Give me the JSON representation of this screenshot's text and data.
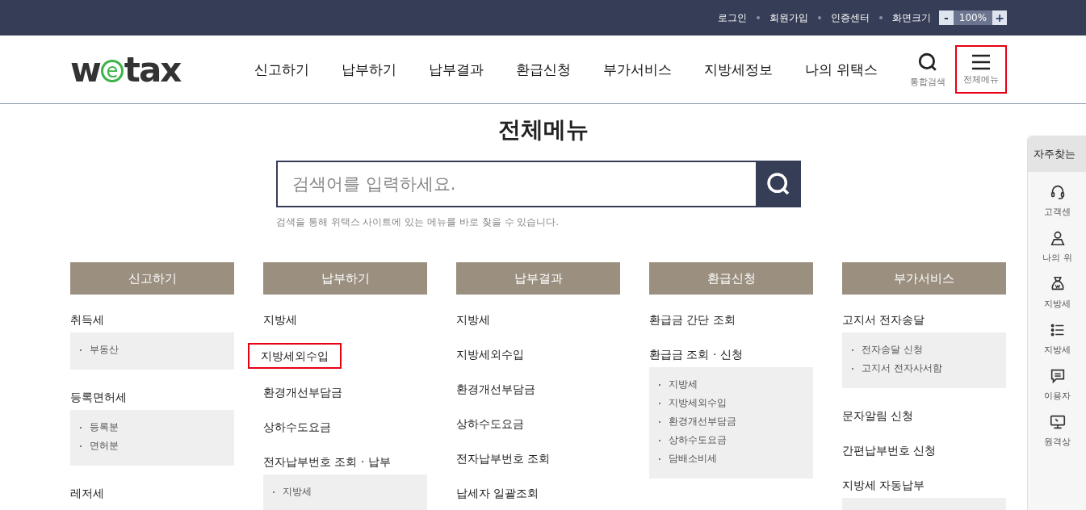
{
  "top_bar": {
    "links": [
      "로그인",
      "회원가입",
      "인증센터"
    ],
    "zoom": {
      "label": "화면크기",
      "minus": "-",
      "value": "100%",
      "plus": "+"
    }
  },
  "header": {
    "logo": {
      "before": "w",
      "mark": "e",
      "after": "tax"
    },
    "nav": [
      "신고하기",
      "납부하기",
      "납부결과",
      "환급신청",
      "부가서비스",
      "지방세정보",
      "나의 위택스"
    ],
    "tools": [
      {
        "kind": "search",
        "label": "통합검색",
        "highlighted": false
      },
      {
        "kind": "menu",
        "label": "전체메뉴",
        "highlighted": true
      }
    ]
  },
  "page_title": "전체메뉴",
  "search": {
    "placeholder": "검색어를 입력하세요.",
    "hint": "검색을 통해 위택스 사이트에 있는 메뉴를 바로 찾을 수 있습니다."
  },
  "columns": [
    {
      "title": "신고하기",
      "groups": [
        {
          "label": "취득세",
          "highlighted": false,
          "expanded": true,
          "items": [
            "부동산"
          ]
        },
        {
          "label": "등록면허세",
          "highlighted": false,
          "expanded": true,
          "items": [
            "등록분",
            "면허분"
          ]
        },
        {
          "label": "레저세",
          "highlighted": false,
          "expanded": false
        }
      ]
    },
    {
      "title": "납부하기",
      "groups": [
        {
          "label": "지방세",
          "highlighted": false,
          "expanded": false
        },
        {
          "label": "지방세외수입",
          "highlighted": true,
          "expanded": false
        },
        {
          "label": "환경개선부담금",
          "highlighted": false,
          "expanded": false
        },
        {
          "label": "상하수도요금",
          "highlighted": false,
          "expanded": false
        },
        {
          "label": "전자납부번호 조회 · 납부",
          "highlighted": false,
          "expanded": true,
          "items": [
            "지방세"
          ]
        }
      ]
    },
    {
      "title": "납부결과",
      "groups": [
        {
          "label": "지방세",
          "highlighted": false,
          "expanded": false
        },
        {
          "label": "지방세외수입",
          "highlighted": false,
          "expanded": false
        },
        {
          "label": "환경개선부담금",
          "highlighted": false,
          "expanded": false
        },
        {
          "label": "상하수도요금",
          "highlighted": false,
          "expanded": false
        },
        {
          "label": "전자납부번호 조회",
          "highlighted": false,
          "expanded": false
        },
        {
          "label": "납세자 일괄조회",
          "highlighted": false,
          "expanded": false
        }
      ]
    },
    {
      "title": "환급신청",
      "groups": [
        {
          "label": "환급금 간단 조회",
          "highlighted": false,
          "expanded": false
        },
        {
          "label": "환급금 조회 · 신청",
          "highlighted": false,
          "expanded": true,
          "items": [
            "지방세",
            "지방세외수입",
            "환경개선부담금",
            "상하수도요금",
            "담배소비세"
          ]
        }
      ]
    },
    {
      "title": "부가서비스",
      "groups": [
        {
          "label": "고지서 전자송달",
          "highlighted": false,
          "expanded": true,
          "items": [
            "전자송달 신청",
            "고지서 전자사서함"
          ]
        },
        {
          "label": "문자알림 신청",
          "highlighted": false,
          "expanded": false
        },
        {
          "label": "간편납부번호 신청",
          "highlighted": false,
          "expanded": false
        },
        {
          "label": "지방세 자동납부",
          "highlighted": false,
          "expanded": true
        }
      ]
    }
  ],
  "quick_panel": {
    "title": "자주찾는",
    "items": [
      {
        "kind": "headset",
        "label": "고객센"
      },
      {
        "kind": "person",
        "label": "나의 위"
      },
      {
        "kind": "moneybag",
        "label": "지방세"
      },
      {
        "kind": "list",
        "label": "지방세"
      },
      {
        "kind": "chat",
        "label": "이용자"
      },
      {
        "kind": "monitor",
        "label": "원격상"
      }
    ]
  }
}
